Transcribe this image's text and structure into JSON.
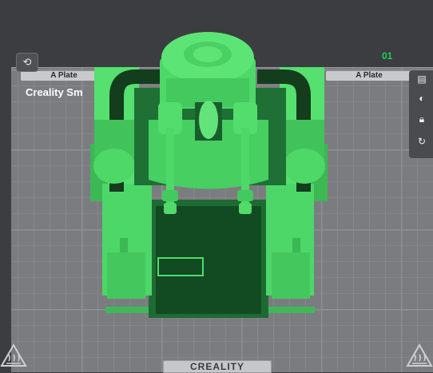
{
  "viewport": {
    "plate_tab_left": "A Plate",
    "plate_tab_right": "A Plate",
    "plate_title": "Creality Sm",
    "plate_index": "01",
    "brand": "CREALITY"
  },
  "icons": {
    "left_tool": "orient-icon",
    "toolbar": [
      "layers-icon",
      "paint-icon",
      "lock-icon",
      "refresh-icon"
    ],
    "heat_left": "heated-bed-icon",
    "heat_right": "heated-bed-icon"
  },
  "colors": {
    "model": "#4fdc6a",
    "plate": "#7b7c80",
    "accent": "#19d24e"
  }
}
